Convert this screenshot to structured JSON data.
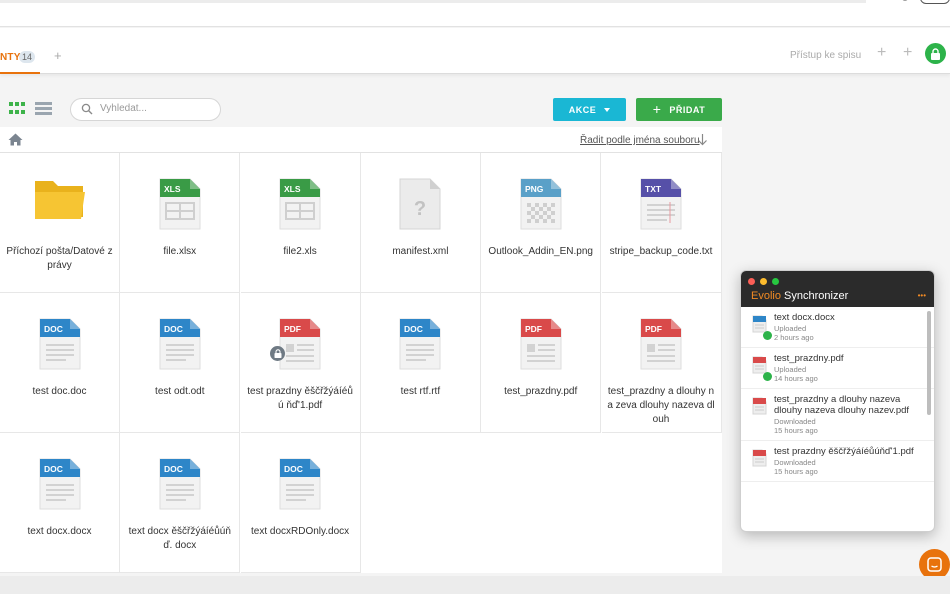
{
  "tabs": {
    "active_label": "NTY",
    "active_count": "14",
    "add_label": "+"
  },
  "header_right": {
    "access_label": "Přístup ke spisu",
    "plus_label": "+",
    "plus2_label": "+"
  },
  "toolbar": {
    "search_placeholder": "Vyhledat...",
    "akce_label": "AKCE",
    "add_label": "PŘIDAT"
  },
  "pathbar": {
    "sort_label": "Řadit podle jména souboru"
  },
  "files": [
    {
      "name": "Příchozí pošta/Datové zprávy",
      "kind": "folder"
    },
    {
      "name": "file.xlsx",
      "kind": "XLS",
      "color": "#3a9b46"
    },
    {
      "name": "file2.xls",
      "kind": "XLS",
      "color": "#3a9b46"
    },
    {
      "name": "manifest.xml",
      "kind": "unknown"
    },
    {
      "name": "Outlook_Addin_EN.png",
      "kind": "PNG",
      "color": "#5aa0c8"
    },
    {
      "name": "stripe_backup_code.txt",
      "kind": "TXT",
      "color": "#5650a8"
    },
    {
      "name": "test doc.doc",
      "kind": "DOC",
      "color": "#2e86c8"
    },
    {
      "name": "test odt.odt",
      "kind": "DOC",
      "color": "#2e86c8"
    },
    {
      "name": "test prazdny ěščřžýáíéůú ňď'1.pdf",
      "kind": "PDF",
      "color": "#d94a4a"
    },
    {
      "name": "test rtf.rtf",
      "kind": "DOC",
      "color": "#2e86c8"
    },
    {
      "name": "test_prazdny.pdf",
      "kind": "PDF",
      "color": "#d94a4a"
    },
    {
      "name": "test_prazdny a dlouhy na zeva dlouhy nazeva dlouh",
      "kind": "PDF",
      "color": "#d94a4a"
    },
    {
      "name": "text docx.docx",
      "kind": "DOC",
      "color": "#2e86c8"
    },
    {
      "name": "text docx ěščřžýáíéůúňď. docx",
      "kind": "DOC",
      "color": "#2e86c8"
    },
    {
      "name": "text docxRDOnly.docx",
      "kind": "DOC",
      "color": "#2e86c8",
      "locked": true
    }
  ],
  "sync": {
    "brand": "Evolio",
    "title": "Synchronizer",
    "menu": "•••",
    "items": [
      {
        "file": "text docx.docx",
        "status": "Uploaded",
        "time": "2 hours ago",
        "kind": "DOC"
      },
      {
        "file": "test_prazdny.pdf",
        "status": "Uploaded",
        "time": "14 hours ago",
        "kind": "PDF"
      },
      {
        "file": "test_prazdny a dlouhy nazeva dlouhy nazeva dlouhy nazev.pdf",
        "status": "Downloaded",
        "time": "15 hours ago",
        "kind": "PDF"
      },
      {
        "file": "test prazdny ěščřžýáíéůúňď'1.pdf",
        "status": "Downloaded",
        "time": "15 hours ago",
        "kind": "PDF"
      }
    ]
  },
  "colors": {
    "accent_orange": "#e8720c",
    "akce_cyan": "#1ab7d4",
    "add_green": "#3aaa4a",
    "lock_green": "#2db34a"
  }
}
